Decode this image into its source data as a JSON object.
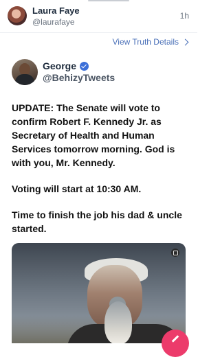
{
  "header": {
    "name": "Laura Faye",
    "handle": "@laurafaye",
    "time": "1h"
  },
  "view_details": {
    "label": "View Truth Details"
  },
  "post": {
    "author_name": "George",
    "author_handle": "@BehizyTweets",
    "paragraphs": [
      "UPDATE: The Senate will vote to confirm Robert F. Kennedy Jr. as Secretary of Health and Human Services tomorrow morning. God is with you, Mr. Kennedy.",
      "Voting will start at 10:30 AM.",
      "Time to finish the job his dad & uncle started."
    ]
  },
  "colors": {
    "accent": "#4a70b8",
    "verified": "#3b6fd8",
    "fab": "#ec3b6b"
  },
  "icons": {
    "verified": "verified-badge-icon",
    "chevron": "chevron-right-icon",
    "media": "media-type-icon",
    "compose": "compose-pencil-icon"
  }
}
